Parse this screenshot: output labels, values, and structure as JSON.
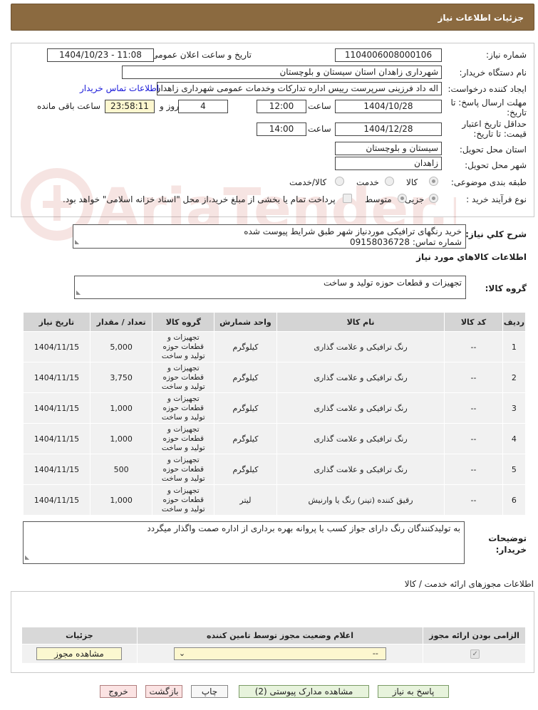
{
  "page_title": "جزئیات اطلاعات نیاز",
  "labels": {
    "need_number": "شماره نیاز:",
    "announce_datetime": "تاریخ و ساعت اعلان عمومی:",
    "buyer_org": "نام دستگاه خریدار:",
    "request_creator": "ایجاد کننده درخواست:",
    "contact_link": "اطلاعات تماس خریدار",
    "reply_deadline": "مهلت ارسال پاسخ: تا تاریخ:",
    "price_validity": "حداقل تاریخ اعتبار قیمت: تا تاریخ:",
    "time": "ساعت",
    "day_and": "روز و",
    "remaining": "ساعت باقی مانده",
    "province": "استان محل تحویل:",
    "city": "شهر محل تحویل:",
    "category": "طبقه بندی موضوعی:",
    "process_type": "نوع فرآیند خرید :",
    "general_desc": "شرح کلي نياز:",
    "goods_info": "اطلاعات کالاهاي مورد نياز",
    "goods_group": "گروه کالا:",
    "buyer_notes": "توضیحات خریدار:",
    "permits_title": "اطلاعات مجوزهای ارائه خدمت / کالا"
  },
  "values": {
    "need_number": "1104006008000106",
    "announce_datetime": "1404/10/23 - 11:08",
    "buyer_org": "شهرداری زاهدان استان سیستان و بلوچستان",
    "request_creator": "اله داد فرزینی سرپرست رییس اداره تدارکات وخدمات عمومی شهرداری زاهدان ا",
    "reply_date": "1404/10/28",
    "reply_time": "12:00",
    "days": "4",
    "remaining_time": "23:58:11",
    "validity_date": "1404/12/28",
    "validity_time": "14:00",
    "province": "سیستان و بلوچستان",
    "city": "زاهدان",
    "general_desc_line1": "خرید رنگهای ترافیکی موردنیاز شهر طبق شرایط پیوست شده",
    "general_desc_line2": "شماره تماس: 09158036728",
    "goods_group": "تجهیزات و قطعات حوزه تولید و ساخت",
    "buyer_notes": "به تولیدکنندگان رنگ دارای جواز کسب یا پروانه بهره برداری از اداره صمت واگذار میگردد"
  },
  "category_options": [
    {
      "label": "کالا",
      "selected": true
    },
    {
      "label": "خدمت",
      "selected": false
    },
    {
      "label": "کالا/خدمت",
      "selected": false
    }
  ],
  "process_options": [
    {
      "label": "جزیی",
      "selected": true
    },
    {
      "label": "متوسط",
      "selected": false
    }
  ],
  "payment_note": "پرداخت تمام یا بخشی از مبلغ خرید،از محل \"اسناد خزانه اسلامی\" خواهد بود.",
  "items_table": {
    "headers": [
      "ردیف",
      "کد کالا",
      "نام کالا",
      "واحد شمارش",
      "گروه کالا",
      "تعداد / مقدار",
      "تاریخ نیاز"
    ],
    "rows": [
      [
        "1",
        "--",
        "رنگ ترافیکی و علامت گذاری",
        "کیلوگرم",
        "تجهیزات و قطعات حوزه تولید و ساخت",
        "5,000",
        "1404/11/15"
      ],
      [
        "2",
        "--",
        "رنگ ترافیکی و علامت گذاری",
        "کیلوگرم",
        "تجهیزات و قطعات حوزه تولید و ساخت",
        "3,750",
        "1404/11/15"
      ],
      [
        "3",
        "--",
        "رنگ ترافیکی و علامت گذاری",
        "کیلوگرم",
        "تجهیزات و قطعات حوزه تولید و ساخت",
        "1,000",
        "1404/11/15"
      ],
      [
        "4",
        "--",
        "رنگ ترافیکی و علامت گذاری",
        "کیلوگرم",
        "تجهیزات و قطعات حوزه تولید و ساخت",
        "1,000",
        "1404/11/15"
      ],
      [
        "5",
        "--",
        "رنگ ترافیکی و علامت گذاری",
        "کیلوگرم",
        "تجهیزات و قطعات حوزه تولید و ساخت",
        "500",
        "1404/11/15"
      ],
      [
        "6",
        "--",
        "رقیق کننده (تینر) رنگ یا وارنیش",
        "لیتر",
        "تجهیزات و قطعات حوزه تولید و ساخت",
        "1,000",
        "1404/11/15"
      ]
    ]
  },
  "permits_table": {
    "headers": [
      "الزامی بودن ارائه مجوز",
      "اعلام وضعیت مجوز توسط تامین کننده",
      "جزئیات"
    ],
    "select_value": "--",
    "view_button": "مشاهده مجوز"
  },
  "buttons": {
    "reply": "پاسخ به نیاز",
    "attachments": "مشاهده مدارک پیوستی (2)",
    "print": "چاپ",
    "back": "بازگشت",
    "exit": "خروج"
  },
  "watermark_text": "AriaTender.net",
  "colors": {
    "header_bg": "#8b6a40",
    "link": "#1a1ad9",
    "field_yellow": "#fdf7cf",
    "watermark": "#c0392b"
  }
}
